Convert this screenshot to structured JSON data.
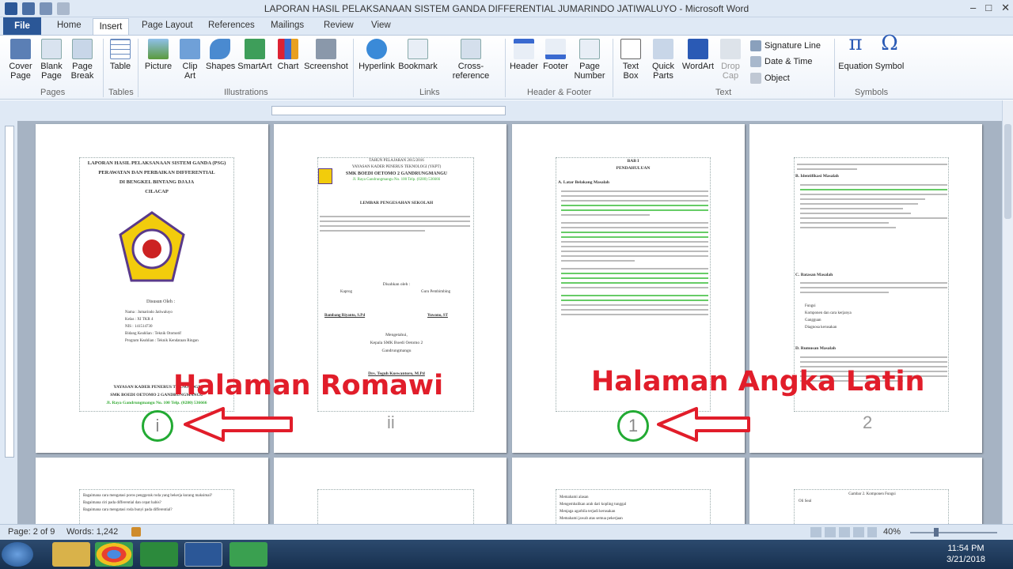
{
  "window": {
    "title": "LAPORAN HASIL PELAKSANAAN SISTEM GANDA DIFFERENTIAL JUMARINDO JATIWALUYO - Microsoft Word",
    "controls": [
      "–",
      "□",
      "✕"
    ]
  },
  "tabs": [
    "File",
    "Home",
    "Insert",
    "Page Layout",
    "References",
    "Mailings",
    "Review",
    "View"
  ],
  "active_tab": "Insert",
  "ribbon": {
    "pages": {
      "cover_page": "Cover Page",
      "blank_page": "Blank Page",
      "page_break": "Page Break",
      "group": "Pages"
    },
    "tables": {
      "table": "Table",
      "group": "Tables"
    },
    "illustrations": {
      "picture": "Picture",
      "clip_art": "Clip Art",
      "shapes": "Shapes",
      "smartart": "SmartArt",
      "chart": "Chart",
      "screenshot": "Screenshot",
      "group": "Illustrations"
    },
    "links": {
      "hyperlink": "Hyperlink",
      "bookmark": "Bookmark",
      "cross_reference": "Cross-reference",
      "group": "Links"
    },
    "header_footer": {
      "header": "Header",
      "footer": "Footer",
      "page_number": "Page Number",
      "group": "Header & Footer"
    },
    "text": {
      "text_box": "Text Box",
      "quick_parts": "Quick Parts",
      "wordart": "WordArt",
      "drop_cap": "Drop Cap",
      "signature_line": "Signature Line",
      "date_time": "Date & Time",
      "object": "Object",
      "group": "Text"
    },
    "symbols": {
      "equation": "Equation",
      "symbol": "Symbol",
      "group": "Symbols"
    }
  },
  "pages": {
    "p1": {
      "title_lines": [
        "LAPORAN HASIL PELAKSANAAN SISTEM GANDA (PSG)",
        "PERAWATAN DAN PERBAIKAN DIFFERENTIAL",
        "DI BENGKEL BINTANG DJAJA",
        "CILACAP"
      ],
      "disusun": "Disusun Oleh :",
      "fields": [
        "Nama : Jumarindo Jatiwaluyo",
        "Kelas : XI TKR 4",
        "NIS : 141514730",
        "Bidang Keahlian : Teknik Otomotif",
        "Program Keahlian : Teknik Kendaraan Ringan"
      ],
      "footer_lines": [
        "YAYASAN KADER PENERUS TEKNOLOGI",
        "SMK BOEDI OETOMO 2 GANDRUNGMANGU",
        "Jl. Raya Gandrungmangu No. 100 Telp. (0280) 536666"
      ],
      "page_number": "i"
    },
    "p2": {
      "header_lines": [
        "TAHUN PELAJARAN 2015/2016",
        "YAYASAN KADER PENERUS TEKNOLOGI (YKPT)",
        "SMK BOEDI OETOMO 2 GANDRUNGMANGU",
        "Jl. Raya Gandrungmangu No. 100 Telp. (0280) 536666"
      ],
      "title": "LEMBAR PENGESAHAN SEKOLAH",
      "disahkan": "Disahkan oleh :",
      "signers": [
        "Kaprog",
        "Guru Pembimbing"
      ],
      "names": [
        "Bambang Riyanto, S.Pd",
        "Yuwono, ST"
      ],
      "closing": [
        "Mengetahui,",
        "Kepala SMK Boedi Oetomo 2",
        "Gandrungmangu"
      ],
      "head": "Drs. Teguh Kuswantoro, M.Pd",
      "page_number": "ii"
    },
    "p3": {
      "bab": "BAB I",
      "title": "PENDAHULUAN",
      "section": "A. Latar Belakang Masalah",
      "page_number": "1"
    },
    "p4": {
      "items": [
        "B. Identifikasi Masalah",
        "C. Batasan Masalah",
        "D. Rumusan Masalah"
      ],
      "list": [
        "Fungsi",
        "Komponen dan cara kerjanya",
        "Gangguan",
        "Diagnosa kerusakan"
      ],
      "page_number": "2"
    },
    "row2": {
      "p5_lines": [
        "Bagaimana cara mengatasi poros penggerak roda yang bekerja kurang maksimal?",
        "Bagaimana ciri pada differential dan cepat habis?",
        "Bagaimana cara mengatasi roda bunyi pada differential?"
      ],
      "p7_lines": [
        "Memahami alasan",
        "Mengembalikan arah dari kopling tunggal",
        "Menjaga agarbila terjadi kerusakan",
        "Memahami jawab atas semua pekerjaan"
      ],
      "p8_lines": [
        "Gambar 2. Komponen Fungsi",
        "Oli Seal"
      ]
    }
  },
  "annotations": {
    "left": "Halaman Romawi",
    "right": "Halaman Angka Latin"
  },
  "status": {
    "page": "Page: 2 of 9",
    "words": "Words: 1,242",
    "zoom": "40%"
  },
  "taskbar": {
    "time": "11:54 PM",
    "date": "3/21/2018"
  }
}
